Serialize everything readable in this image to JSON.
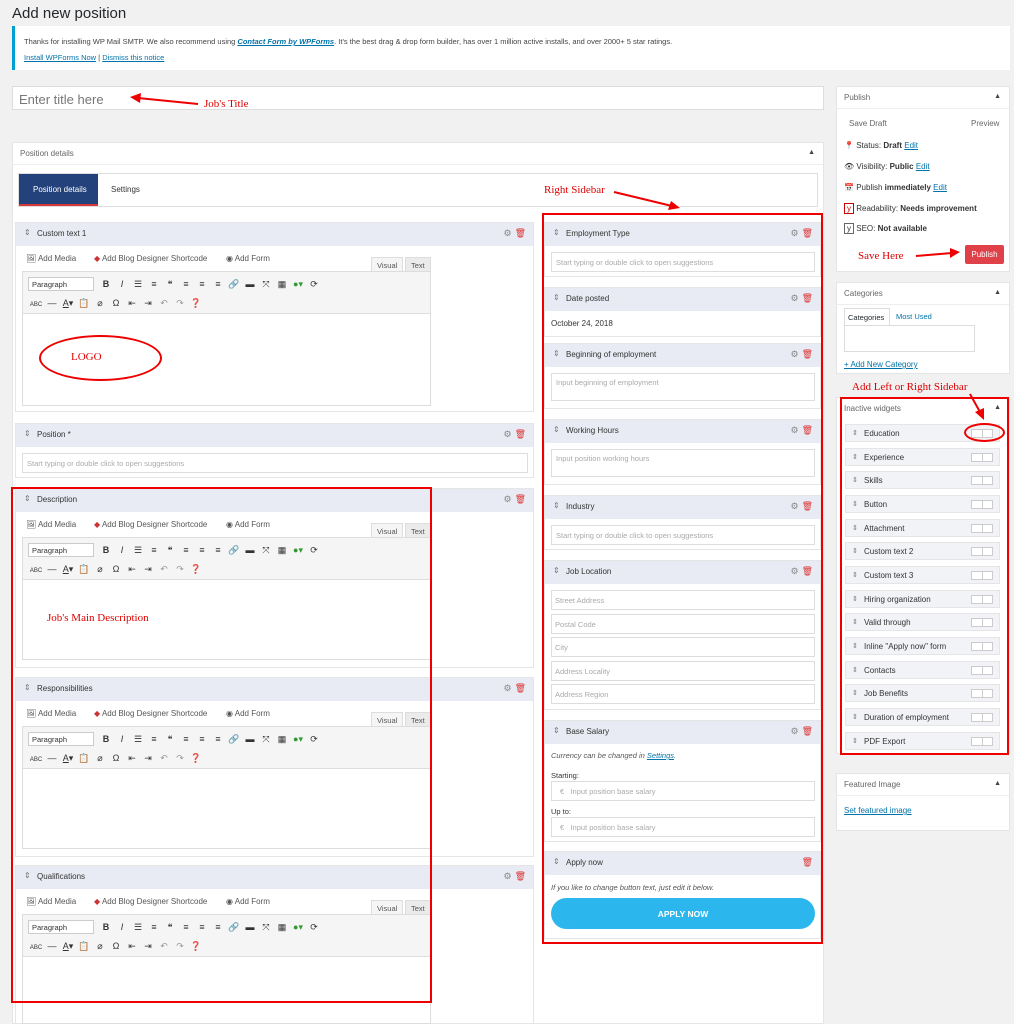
{
  "page": {
    "title": "Add new position"
  },
  "notice": {
    "text_before": "Thanks for installing WP Mail SMTP. We also recommend using ",
    "link_text": "Contact Form by WPForms",
    "text_after": ". It's the best drag & drop form builder, has over 1 million active installs, and over 2000+ 5 star ratings.",
    "install_link": "Install WPForms Now",
    "separator": " | ",
    "dismiss_link": "Dismiss this notice"
  },
  "title_input": {
    "placeholder": "Enter title here"
  },
  "position_details": {
    "title": "Position details",
    "tabs": [
      {
        "label": "Position details"
      },
      {
        "label": "Settings"
      }
    ]
  },
  "editor": {
    "add_media": "Add Media",
    "add_shortcode": "Add Blog Designer Shortcode",
    "add_form": "Add Form",
    "visual": "Visual",
    "text": "Text",
    "format": "Paragraph"
  },
  "left_widgets": {
    "custom_text_1": "Custom text 1",
    "position": "Position *",
    "position_placeholder": "Start typing or double click to open suggestions",
    "description": "Description",
    "responsibilities": "Responsibilities",
    "qualifications": "Qualifications"
  },
  "right_widgets": {
    "employment_type": "Employment Type",
    "employment_placeholder": "Start typing or double click to open suggestions",
    "date_posted": "Date posted",
    "date_value": "October 24, 2018",
    "beginning": "Beginning of employment",
    "beginning_placeholder": "Input beginning of employment",
    "working_hours": "Working Hours",
    "working_placeholder": "Input position working hours",
    "industry": "Industry",
    "industry_placeholder": "Start typing or double click to open suggestions",
    "job_location": "Job Location",
    "address_fields": [
      "Street Address",
      "Postal Code",
      "City",
      "Address Locality",
      "Address Region"
    ],
    "base_salary": "Base Salary",
    "currency_note": "Currency can be changed in ",
    "settings_link": "Settings",
    "currency_note_end": ".",
    "starting": "Starting:",
    "up_to": "Up to:",
    "currency_symbol": "€",
    "salary_placeholder": "Input position base salary",
    "apply_now": "Apply now",
    "apply_note": "If you like to change button text, just edit it below.",
    "apply_button": "APPLY NOW"
  },
  "publish": {
    "title": "Publish",
    "save_draft": "Save Draft",
    "preview": "Preview",
    "status_label": "Status: ",
    "status_value": "Draft",
    "visibility_label": "Visibility: ",
    "visibility_value": "Public",
    "publish_label": "Publish ",
    "publish_value": "immediately",
    "readability_label": "Readability: ",
    "readability_value": "Needs improvement",
    "seo_label": "SEO: ",
    "seo_value": "Not available",
    "edit": "Edit",
    "publish_button": "Publish"
  },
  "categories": {
    "title": "Categories",
    "tab_all": "Categories",
    "tab_most": "Most Used",
    "add_new": "+ Add New Category"
  },
  "inactive_widgets": {
    "title": "Inactive widgets",
    "items": [
      "Education",
      "Experience",
      "Skills",
      "Button",
      "Attachment",
      "Custom text 2",
      "Custom text 3",
      "Hiring organization",
      "Valid through",
      "Inline \"Apply now\" form",
      "Contacts",
      "Job Benefits",
      "Duration of employment",
      "PDF Export"
    ]
  },
  "featured_image": {
    "title": "Featured Image",
    "link": "Set featured image"
  },
  "annotations": {
    "jobs_title": "Job's Title",
    "logo": "LOGO",
    "main_description": "Job's Main Description",
    "right_sidebar": "Right Sidebar",
    "save_here": "Save Here",
    "add_sidebar": "Add Left or Right Sidebar"
  },
  "colors": {
    "accent_red": "#e00000",
    "publish_button": "#e04047",
    "tab_active": "#23417a",
    "apply_button": "#2bb7ee"
  }
}
